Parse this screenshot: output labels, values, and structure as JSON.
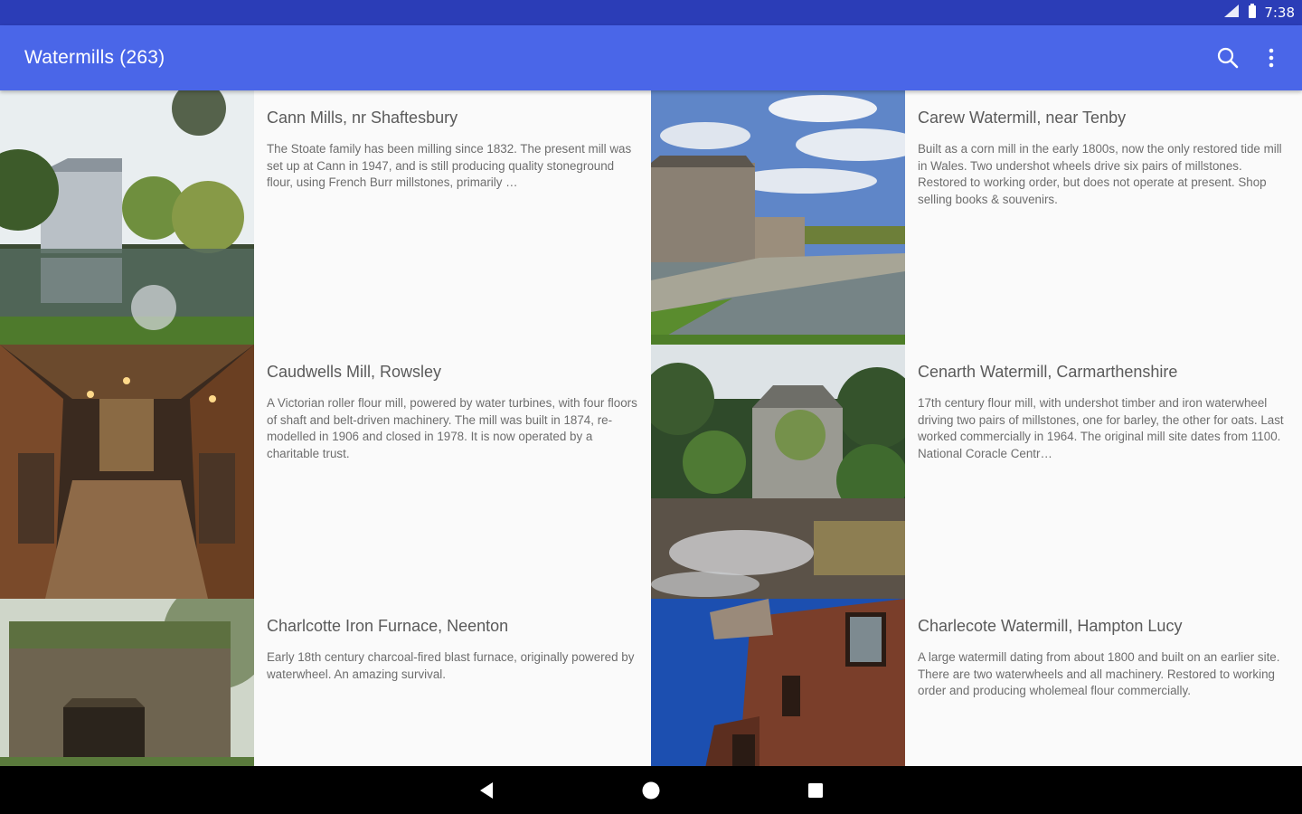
{
  "status_bar": {
    "time": "7:38",
    "icons": [
      "signal-icon",
      "battery-icon"
    ]
  },
  "app_bar": {
    "title": "Watermills (263)",
    "actions": [
      "search-icon",
      "more-vert-icon"
    ]
  },
  "colors": {
    "status_bar": "#2b3db7",
    "app_bar": "#4a66e8",
    "background": "#fafafa",
    "nav_bar": "#000000"
  },
  "mills": [
    {
      "title": "Cann Mills, nr Shaftesbury",
      "description": "The Stoate family has been milling since 1832. The present mill was set up at Cann in 1947, and is still producing quality stoneground flour, using French Burr millstones, primarily …"
    },
    {
      "title": "Carew Watermill, near Tenby",
      "description": "Built as a corn mill in the early 1800s, now the only restored tide mill in Wales. Two undershot wheels drive six pairs of millstones. Restored to working order, but does not operate at present. Shop selling books & souvenirs."
    },
    {
      "title": "Caudwells Mill, Rowsley",
      "description": "A Victorian roller flour mill, powered by water turbines, with four floors of shaft and belt-driven machinery. The mill was built in 1874, re-modelled in 1906 and closed in 1978. It is now operated by a charitable trust."
    },
    {
      "title": "Cenarth Watermill, Carmarthenshire",
      "description": "17th century flour mill, with undershot timber and iron waterwheel driving two pairs of millstones, one for barley, the other for oats. Last worked commercially in 1964. The original mill site dates from 1100. National Coracle Centr…"
    },
    {
      "title": "Charlcotte Iron Furnace, Neenton",
      "description": "Early 18th century charcoal-fired blast furnace, originally powered by waterwheel. An amazing survival."
    },
    {
      "title": "Charlecote Watermill, Hampton Lucy",
      "description": "A large watermill dating from about 1800 and built on an earlier site. There are two waterwheels and all machinery. Restored to working order and producing wholemeal flour commercially."
    }
  ],
  "nav_bar": {
    "buttons": [
      "back-icon",
      "home-icon",
      "recents-icon"
    ]
  }
}
